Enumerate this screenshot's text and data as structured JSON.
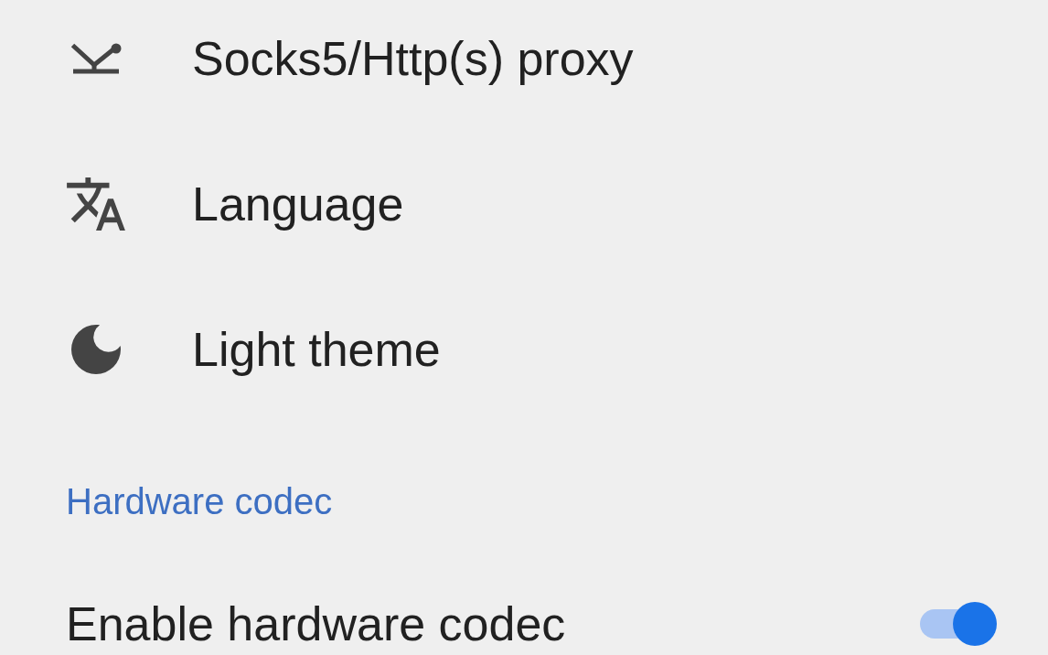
{
  "settings": {
    "proxy": {
      "label": "Socks5/Http(s) proxy"
    },
    "language": {
      "label": "Language"
    },
    "theme": {
      "label": "Light theme"
    }
  },
  "hardware_codec": {
    "header": "Hardware codec",
    "enable": {
      "label": "Enable hardware codec",
      "on": true
    }
  }
}
